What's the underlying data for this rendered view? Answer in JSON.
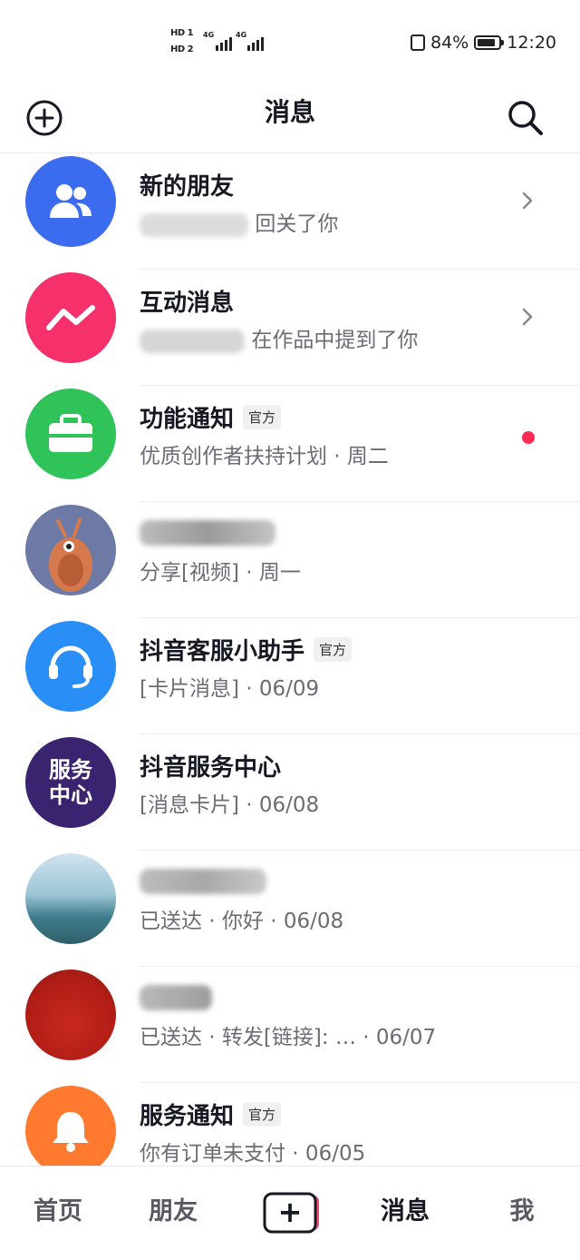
{
  "status_bar": {
    "sim1": "HD 1",
    "sim2": "HD 2",
    "network1": "4G",
    "network2": "4G",
    "battery_percent": "84%",
    "battery_level": 0.84,
    "time": "12:20"
  },
  "header": {
    "title": "消息",
    "add_icon": "plus-circle-icon",
    "search_icon": "search-icon"
  },
  "messages": [
    {
      "title": "新的朋友",
      "subtitle": "回关了你",
      "official": "",
      "has_chevron": true,
      "unread_dot": false
    },
    {
      "title": "互动消息",
      "subtitle": "在作品中提到了你",
      "official": "",
      "has_chevron": true,
      "unread_dot": false
    },
    {
      "title": "功能通知",
      "subtitle": "优质创作者扶持计划 · 周二",
      "official": "官方",
      "has_chevron": false,
      "unread_dot": true
    },
    {
      "title": "",
      "subtitle": "分享[视频] · 周一",
      "official": "",
      "has_chevron": false,
      "unread_dot": false
    },
    {
      "title": "抖音客服小助手",
      "subtitle": "[卡片消息] · 06/09",
      "official": "官方",
      "has_chevron": false,
      "unread_dot": false
    },
    {
      "title": "抖音服务中心",
      "subtitle": "[消息卡片] · 06/08",
      "official": "",
      "has_chevron": false,
      "unread_dot": false
    },
    {
      "title": "",
      "subtitle": "已送达 · 你好 · 06/08",
      "official": "",
      "has_chevron": false,
      "unread_dot": false
    },
    {
      "title": "",
      "subtitle": "已送达 · 转发[链接]: … · 06/07",
      "official": "",
      "has_chevron": false,
      "unread_dot": false
    },
    {
      "title": "服务通知",
      "subtitle": "你有订单未支付 · 06/05",
      "official": "官方",
      "has_chevron": false,
      "unread_dot": false
    }
  ],
  "avatar_texts": {
    "service_center_line1": "服务",
    "service_center_line2": "中心"
  },
  "bottom_nav": {
    "home": "首页",
    "friends": "朋友",
    "create": "+",
    "messages": "消息",
    "me": "我"
  },
  "colors": {
    "accent_red": "#fe2c55",
    "new_friends": "#3b6cf0",
    "interactions": "#f5306a",
    "feature_notice": "#2fc35a",
    "customer_service": "#2a8ef7",
    "service_notice": "#ff7a2e"
  }
}
